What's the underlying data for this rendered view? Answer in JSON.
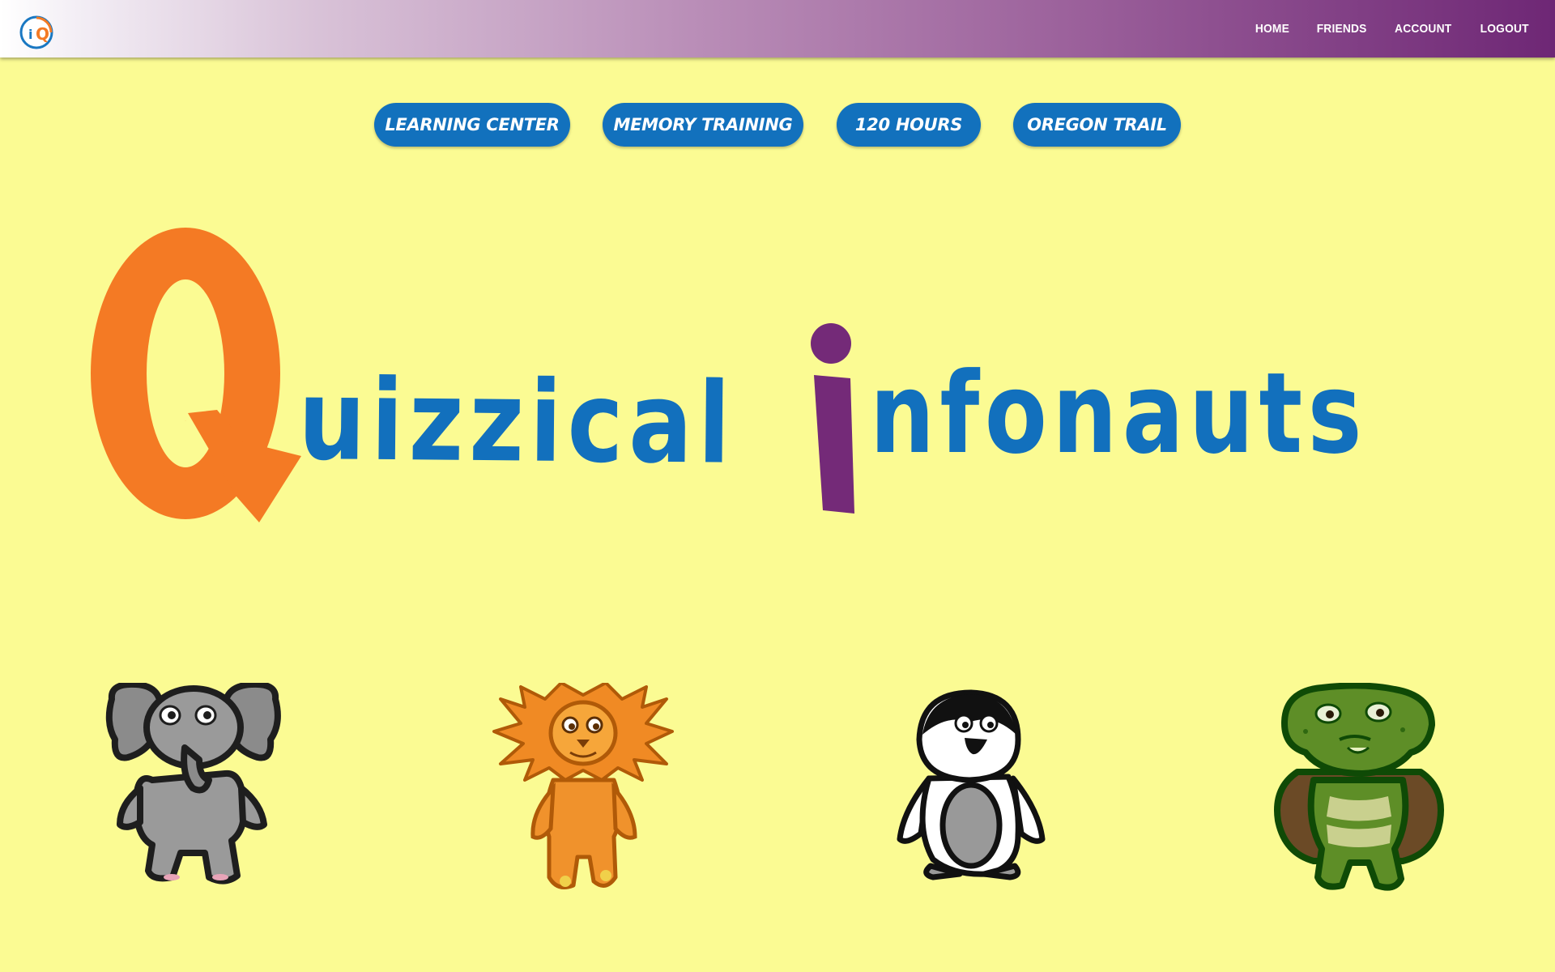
{
  "header": {
    "logo_text": "iQ",
    "nav": [
      {
        "label": "HOME"
      },
      {
        "label": "FRIENDS"
      },
      {
        "label": "ACCOUNT"
      },
      {
        "label": "LOGOUT"
      }
    ]
  },
  "menu": {
    "buttons": [
      {
        "label": "LEARNING CENTER"
      },
      {
        "label": "MEMORY TRAINING"
      },
      {
        "label": "120 HOURS"
      },
      {
        "label": "OREGON TRAIL"
      }
    ]
  },
  "hero": {
    "title_q": "Q",
    "title_rest_1": "uizzical",
    "title_i": "i",
    "title_rest_2": "nfonauts"
  },
  "characters": [
    {
      "icon": "elephant-icon"
    },
    {
      "icon": "lion-icon"
    },
    {
      "icon": "penguin-icon"
    },
    {
      "icon": "turtle-icon"
    }
  ],
  "colors": {
    "background": "#fbfb93",
    "button_blue": "#1271bd",
    "title_orange": "#f47a24",
    "title_purple": "#742a78",
    "title_blue": "#1270bd"
  }
}
